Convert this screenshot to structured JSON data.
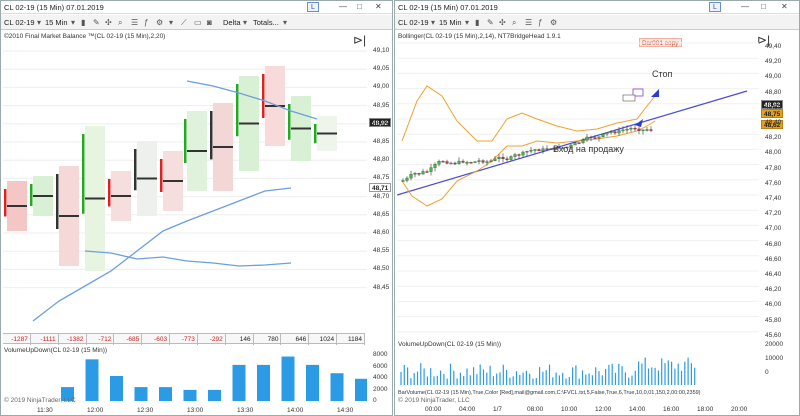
{
  "left": {
    "title": "CL 02-19 (15 Min)  07.01.2019",
    "toolbar": {
      "instrument": "CL 02-19",
      "interval": "15 Min",
      "delta": "Delta",
      "totals": "Totals..."
    },
    "indicator_label": "©2010 Final Market Balance ™(CL 02-19 (15 Min),2,20)",
    "price_axis": [
      "49,10",
      "49,05",
      "49,00",
      "48,95",
      "48,90",
      "48,85",
      "48,80",
      "48,75",
      "48,70",
      "48,65",
      "48,60",
      "48,55",
      "48,50",
      "48,45"
    ],
    "last_price": "48,92",
    "tag_price": "48,71",
    "delta_row": [
      "-1287",
      "-1111",
      "-1382",
      "-712",
      "-685",
      "-603",
      "-773",
      "-292",
      "146",
      "780",
      "646",
      "1024",
      "1184"
    ],
    "volume_label": "VolumeUpDown(CL 02-19 (15 Min))",
    "volume_axis": [
      "8000",
      "6000",
      "4000",
      "2000",
      "0"
    ],
    "time_axis": [
      "11:30",
      "12:00",
      "12:30",
      "13:00",
      "13:30",
      "14:00",
      "14:30"
    ],
    "copyright": "© 2019 NinjaTrader, LLC",
    "lbtn": "L"
  },
  "right": {
    "title": "CL 02-19 (15 Min)  07.01.2019",
    "toolbar": {
      "instrument": "CL 02-19",
      "interval": "15 Min"
    },
    "indicator_label": "Bollinger(CL 02-19 (15 Min),2,14), NT7BridgeHead 1.9.1",
    "status_tag": "Bar001 copy",
    "price_axis": [
      "49,40",
      "49,20",
      "49,00",
      "48,80",
      "48,60",
      "48,40",
      "48,20",
      "48,00",
      "47,80",
      "47,60",
      "47,40",
      "47,20",
      "47,00",
      "46,80",
      "46,60",
      "46,40",
      "46,20",
      "46,00",
      "45,80",
      "45,60"
    ],
    "price_tags": {
      "last": "48,92",
      "mid": "48,75",
      "low": "48,62"
    },
    "annotations": {
      "stop": "Стоп",
      "entry": "Вход на продажу"
    },
    "volume_label": "VolumeUpDown(CL 02-19 (15 Min))",
    "volume_axis": [
      "20000",
      "10000",
      "0"
    ],
    "volume_footer": "BarVolume(CL 02-19 (15 Min),True,Color [Red],mail@gmail.com,C:\\FVCL.txt,5,False,True,6,True,10,0,01,150,2,00:00,2359)",
    "time_axis": [
      "00:00",
      "04:00",
      "1/7",
      "08:00",
      "10:00",
      "12:00",
      "14:00",
      "16:00",
      "18:00",
      "20:00"
    ],
    "copyright": "© 2019 NinjaTrader, LLC",
    "lbtn": "L"
  }
}
